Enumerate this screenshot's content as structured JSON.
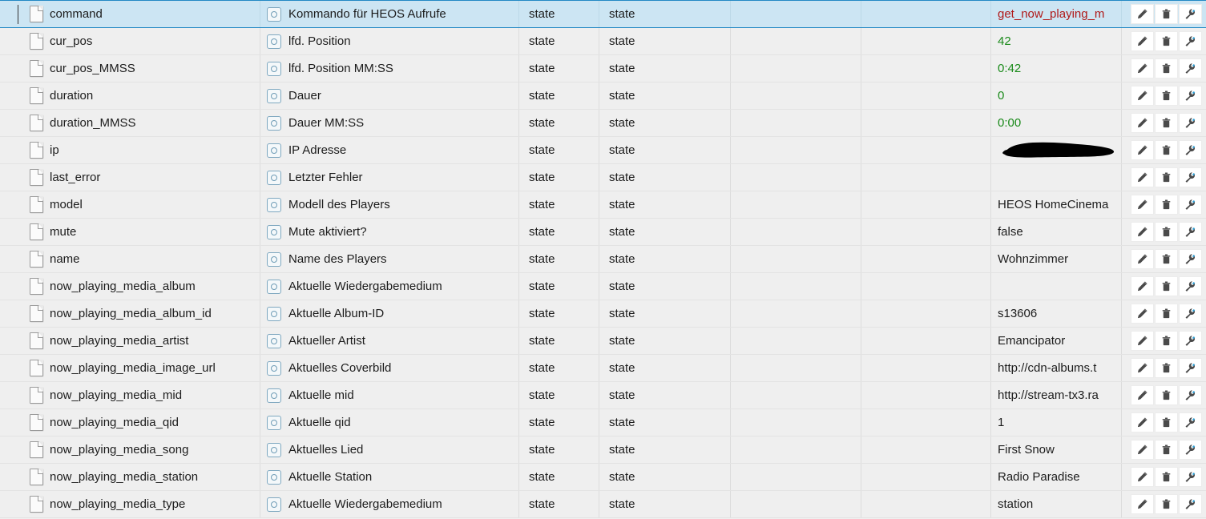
{
  "grid": {
    "columns": [
      "name",
      "description",
      "role",
      "type",
      "col5",
      "col6",
      "value",
      "actions"
    ],
    "icons": {
      "file": "file-icon",
      "state": "state-icon",
      "edit": "pencil-icon",
      "delete": "trash-icon",
      "settings": "wrench-icon"
    },
    "colors": {
      "selected_bg": "#cce5f3",
      "selected_border": "#2389c4",
      "row_bg": "#efefef",
      "value_green": "#1a8a1a",
      "value_red": "#b01818",
      "value_dark": "#1c1c1c"
    },
    "rows": [
      {
        "name": "command",
        "description": "Kommando für HEOS Aufrufe",
        "role": "state",
        "type": "state",
        "value": "get_now_playing_m",
        "value_color": "red",
        "selected": true,
        "redacted": false
      },
      {
        "name": "cur_pos",
        "description": "lfd. Position",
        "role": "state",
        "type": "state",
        "value": "42",
        "value_color": "green",
        "selected": false,
        "redacted": false
      },
      {
        "name": "cur_pos_MMSS",
        "description": "lfd. Position MM:SS",
        "role": "state",
        "type": "state",
        "value": "0:42",
        "value_color": "green",
        "selected": false,
        "redacted": false
      },
      {
        "name": "duration",
        "description": "Dauer",
        "role": "state",
        "type": "state",
        "value": "0",
        "value_color": "green",
        "selected": false,
        "redacted": false
      },
      {
        "name": "duration_MMSS",
        "description": "Dauer MM:SS",
        "role": "state",
        "type": "state",
        "value": "0:00",
        "value_color": "green",
        "selected": false,
        "redacted": false
      },
      {
        "name": "ip",
        "description": "IP Adresse",
        "role": "state",
        "type": "state",
        "value": "",
        "value_color": "dark",
        "selected": false,
        "redacted": true
      },
      {
        "name": "last_error",
        "description": "Letzter Fehler",
        "role": "state",
        "type": "state",
        "value": "",
        "value_color": "dark",
        "selected": false,
        "redacted": false
      },
      {
        "name": "model",
        "description": "Modell des Players",
        "role": "state",
        "type": "state",
        "value": "HEOS HomeCinema",
        "value_color": "dark",
        "selected": false,
        "redacted": false
      },
      {
        "name": "mute",
        "description": "Mute aktiviert?",
        "role": "state",
        "type": "state",
        "value": "false",
        "value_color": "dark",
        "selected": false,
        "redacted": false
      },
      {
        "name": "name",
        "description": "Name des Players",
        "role": "state",
        "type": "state",
        "value": "Wohnzimmer",
        "value_color": "dark",
        "selected": false,
        "redacted": false
      },
      {
        "name": "now_playing_media_album",
        "description": "Aktuelle Wiedergabemedium",
        "role": "state",
        "type": "state",
        "value": "",
        "value_color": "dark",
        "selected": false,
        "redacted": false
      },
      {
        "name": "now_playing_media_album_id",
        "description": "Aktuelle Album-ID",
        "role": "state",
        "type": "state",
        "value": "s13606",
        "value_color": "dark",
        "selected": false,
        "redacted": false
      },
      {
        "name": "now_playing_media_artist",
        "description": "Aktueller Artist",
        "role": "state",
        "type": "state",
        "value": "Emancipator",
        "value_color": "dark",
        "selected": false,
        "redacted": false
      },
      {
        "name": "now_playing_media_image_url",
        "description": "Aktuelles Coverbild",
        "role": "state",
        "type": "state",
        "value": "http://cdn-albums.t",
        "value_color": "dark",
        "selected": false,
        "redacted": false
      },
      {
        "name": "now_playing_media_mid",
        "description": "Aktuelle mid",
        "role": "state",
        "type": "state",
        "value": "http://stream-tx3.ra",
        "value_color": "dark",
        "selected": false,
        "redacted": false
      },
      {
        "name": "now_playing_media_qid",
        "description": "Aktuelle qid",
        "role": "state",
        "type": "state",
        "value": "1",
        "value_color": "dark",
        "selected": false,
        "redacted": false
      },
      {
        "name": "now_playing_media_song",
        "description": "Aktuelles Lied",
        "role": "state",
        "type": "state",
        "value": "First Snow",
        "value_color": "dark",
        "selected": false,
        "redacted": false
      },
      {
        "name": "now_playing_media_station",
        "description": "Aktuelle Station",
        "role": "state",
        "type": "state",
        "value": "Radio Paradise",
        "value_color": "dark",
        "selected": false,
        "redacted": false
      },
      {
        "name": "now_playing_media_type",
        "description": "Aktuelle Wiedergabemedium",
        "role": "state",
        "type": "state",
        "value": "station",
        "value_color": "dark",
        "selected": false,
        "redacted": false
      }
    ]
  }
}
